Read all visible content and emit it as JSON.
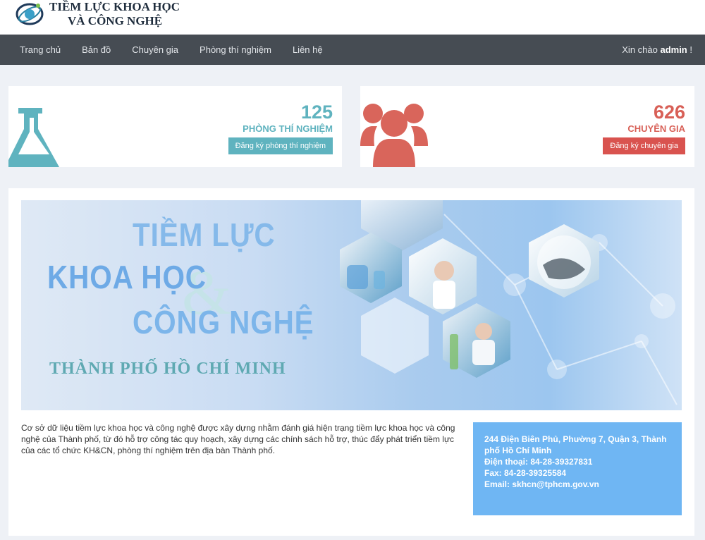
{
  "header": {
    "logo_line1": "TIỀM LỰC KHOA HỌC",
    "logo_line2": "VÀ CÔNG NGHỆ",
    "logo_icon": "globe-atom-icon"
  },
  "nav": {
    "items": [
      {
        "label": "Trang chủ"
      },
      {
        "label": "Bản đồ"
      },
      {
        "label": "Chuyên gia"
      },
      {
        "label": "Phòng thí nghiệm"
      },
      {
        "label": "Liên hệ"
      }
    ],
    "greeting_prefix": "Xin chào ",
    "greeting_user": "admin",
    "greeting_suffix": " !"
  },
  "stats": {
    "lab": {
      "count": "125",
      "label": "PHÒNG THÍ NGHIỆM",
      "button": "Đăng ký phòng thí nghiệm",
      "icon": "flask-icon",
      "color": "#5fb3bf"
    },
    "expert": {
      "count": "626",
      "label": "CHUYÊN GIA",
      "button": "Đăng ký chuyên gia",
      "icon": "users-icon",
      "color": "#d9534f"
    }
  },
  "banner": {
    "line1": "TIỀM LỰC",
    "line2": "KHOA HỌC",
    "line3": "CÔNG NGHỆ",
    "city": "THÀNH PHỐ HỒ CHÍ MINH"
  },
  "description": "Cơ sở dữ liệu tiềm lực khoa học và công nghệ được xây dựng nhằm đánh giá hiện trạng tiềm lực khoa học và công nghệ của Thành phố, từ đó hỗ trợ công tác quy hoạch, xây dựng các chính sách hỗ trợ, thúc đẩy phát triển tiềm lực của các tổ chức KH&CN, phòng thí nghiệm trên địa bàn Thành phố.",
  "contact": {
    "address": "244 Điện Biên Phủ, Phường 7, Quận 3, Thành phố Hồ Chí Minh",
    "phone": "Điện thoại: 84-28-39327831",
    "fax": "Fax: 84-28-39325584",
    "email": "Email: skhcn@tphcm.gov.vn"
  }
}
